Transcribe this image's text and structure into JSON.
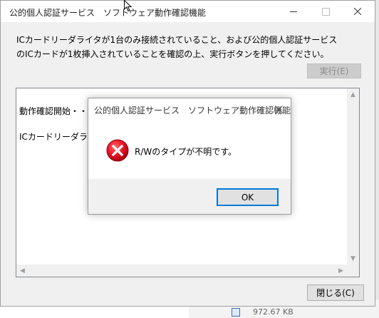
{
  "background": {
    "file_size": "972.67 KB"
  },
  "main_window": {
    "title": "公的個人認証サービス　ソフトウェア動作確認機能",
    "controls": {
      "minimize_icon": "minimize-icon",
      "maximize_icon": "maximize-icon",
      "close_icon": "close-icon"
    },
    "instruction_line1": "ICカードリーダライタが1台のみ接続されていること、および公的個人認証サービス",
    "instruction_line2": "のICカードが1枚挿入されていることを確認の上、実行ボタンを押してください。",
    "run_button": "実行(E)",
    "log_lines": [
      "動作確認開始・・・・・",
      "ICカードリーダライタ接続状態確認"
    ],
    "close_button": "閉じる(C)"
  },
  "dialog": {
    "title": "公的個人認証サービス　ソフトウェア動作確認機能",
    "message": "R/Wのタイプが不明です。",
    "ok_button": "OK",
    "icon": "error-icon",
    "accent_color": "#0078d7",
    "error_color": "#e81123"
  }
}
